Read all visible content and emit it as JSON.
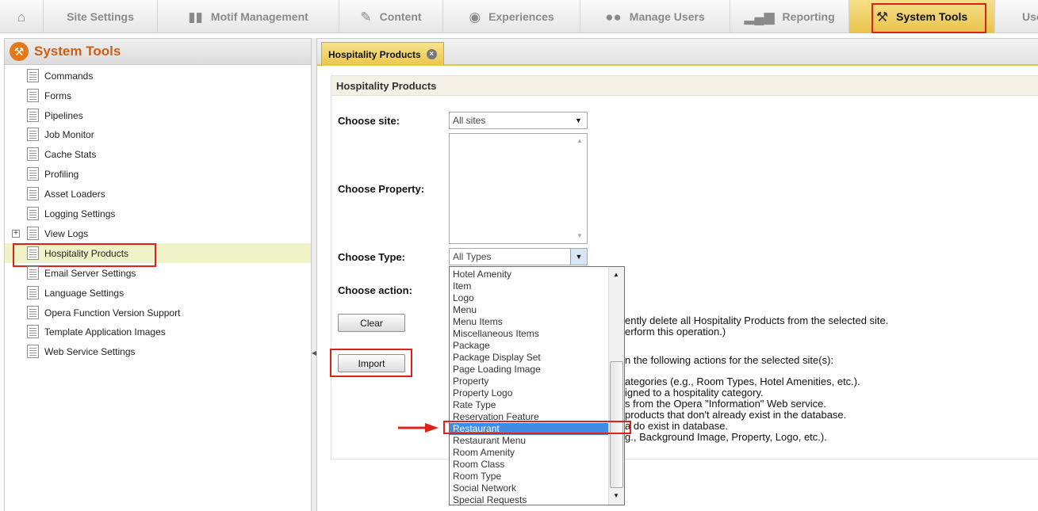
{
  "nav": {
    "tabs": [
      {
        "label": "",
        "icon": "home-icon"
      },
      {
        "label": "Site Settings",
        "icon": ""
      },
      {
        "label": "Motif Management",
        "icon": "motif-icon"
      },
      {
        "label": "Content",
        "icon": "content-edit-icon"
      },
      {
        "label": "Experiences",
        "icon": "globe-icon"
      },
      {
        "label": "Manage Users",
        "icon": "users-icon"
      },
      {
        "label": "Reporting",
        "icon": "bar-chart-icon"
      },
      {
        "label": "System Tools",
        "icon": "tools-icon"
      },
      {
        "label": "Use",
        "icon": ""
      }
    ]
  },
  "sidebar": {
    "title": "System Tools",
    "items": [
      {
        "label": "Commands"
      },
      {
        "label": "Forms"
      },
      {
        "label": "Pipelines"
      },
      {
        "label": "Job Monitor"
      },
      {
        "label": "Cache Stats"
      },
      {
        "label": "Profiling"
      },
      {
        "label": "Asset Loaders"
      },
      {
        "label": "Logging Settings"
      },
      {
        "label": "View Logs"
      },
      {
        "label": "Hospitality Products"
      },
      {
        "label": "Email Server Settings"
      },
      {
        "label": "Language Settings"
      },
      {
        "label": "Opera Function Version Support"
      },
      {
        "label": "Template Application Images"
      },
      {
        "label": "Web Service Settings"
      }
    ],
    "selected": "Hospitality Products"
  },
  "main": {
    "tab_label": "Hospitality Products",
    "section_title": "Hospitality Products",
    "site_label": "Choose site:",
    "site_value": "All sites",
    "property_label": "Choose Property:",
    "type_label": "Choose Type:",
    "type_value": "All Types",
    "action_label": "Choose action:",
    "clear_button": "Clear",
    "import_button": "Import",
    "clear_desc_lines": [
      "ently delete all Hospitality Products from the selected site.",
      "erform this operation.)"
    ],
    "import_desc_lines": [
      "n the following actions for the selected site(s):",
      "ategories (e.g., Room Types, Hotel Amenities, etc.).",
      "igned to a hospitality category.",
      "s from the Opera \"Information\" Web service.",
      "products that don't already exist in the database.",
      "a do exist in database.",
      "g., Background Image, Property, Logo, etc.)."
    ]
  },
  "type_dropdown": {
    "options": [
      "Hotel Amenity",
      "Item",
      "Logo",
      "Menu",
      "Menu Items",
      "Miscellaneous Items",
      "Package",
      "Package Display Set",
      "Page Loading Image",
      "Property",
      "Property Logo",
      "Rate Type",
      "Reservation Feature",
      "Restaurant",
      "Restaurant Menu",
      "Room Amenity",
      "Room Class",
      "Room Type",
      "Social Network",
      "Special Requests"
    ],
    "highlighted": "Restaurant"
  },
  "colors": {
    "accent_orange": "#cc5f17",
    "active_tab": "#e9c24a",
    "highlight_blue": "#3f8ce6",
    "annotation_red": "#e0201a"
  }
}
